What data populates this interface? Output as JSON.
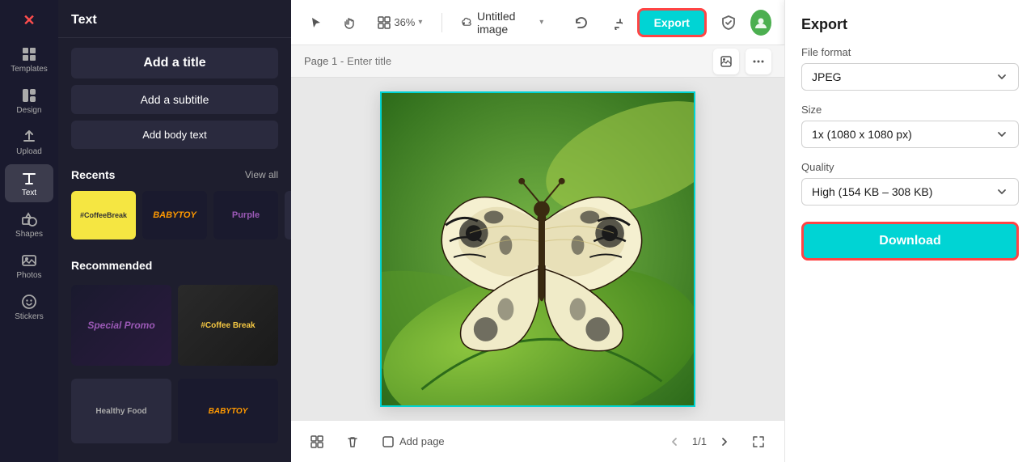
{
  "app": {
    "logo": "✕",
    "project_name": "Untitled image",
    "project_name_caret": "▾"
  },
  "toolbar": {
    "zoom_level": "36%",
    "zoom_caret": "▾",
    "export_label": "Export",
    "undo_icon": "undo-icon",
    "redo_icon": "redo-icon"
  },
  "left_panel": {
    "header": "Text",
    "add_title_label": "Add a title",
    "add_subtitle_label": "Add a subtitle",
    "add_body_label": "Add body text",
    "recents_label": "Recents",
    "view_all_label": "View all",
    "recents": [
      {
        "id": 1,
        "label": "#CoffeeBreak",
        "style": "coffee"
      },
      {
        "id": 2,
        "label": "BABYTOY",
        "style": "babytoy"
      },
      {
        "id": 3,
        "label": "Purple",
        "style": "purple"
      }
    ],
    "recommended_label": "Recommended",
    "recommended": [
      {
        "id": 1,
        "label": "Special Promo",
        "style": "special-promo"
      },
      {
        "id": 2,
        "label": "#Coffee Break",
        "style": "coffee-break-rec"
      }
    ]
  },
  "sidebar": {
    "items": [
      {
        "id": "templates",
        "label": "Templates",
        "icon": "grid-icon"
      },
      {
        "id": "design",
        "label": "Design",
        "icon": "design-icon"
      },
      {
        "id": "upload",
        "label": "Upload",
        "icon": "upload-icon"
      },
      {
        "id": "text",
        "label": "Text",
        "icon": "text-icon",
        "active": true
      },
      {
        "id": "shapes",
        "label": "Shapes",
        "icon": "shapes-icon"
      },
      {
        "id": "photos",
        "label": "Photos",
        "icon": "photos-icon"
      },
      {
        "id": "stickers",
        "label": "Stickers",
        "icon": "stickers-icon"
      }
    ]
  },
  "canvas": {
    "page_label": "Page 1 -",
    "page_title_placeholder": "Enter title",
    "image_alt": "Butterfly on leaf"
  },
  "bottom_bar": {
    "add_page_label": "Add page",
    "page_current": "1/1"
  },
  "export_panel": {
    "title": "Export",
    "file_format_label": "File format",
    "file_format_value": "JPEG",
    "size_label": "Size",
    "size_value": "1x (1080 x 1080 px)",
    "quality_label": "Quality",
    "quality_value": "High (154 KB – 308 KB)",
    "download_label": "Download"
  }
}
